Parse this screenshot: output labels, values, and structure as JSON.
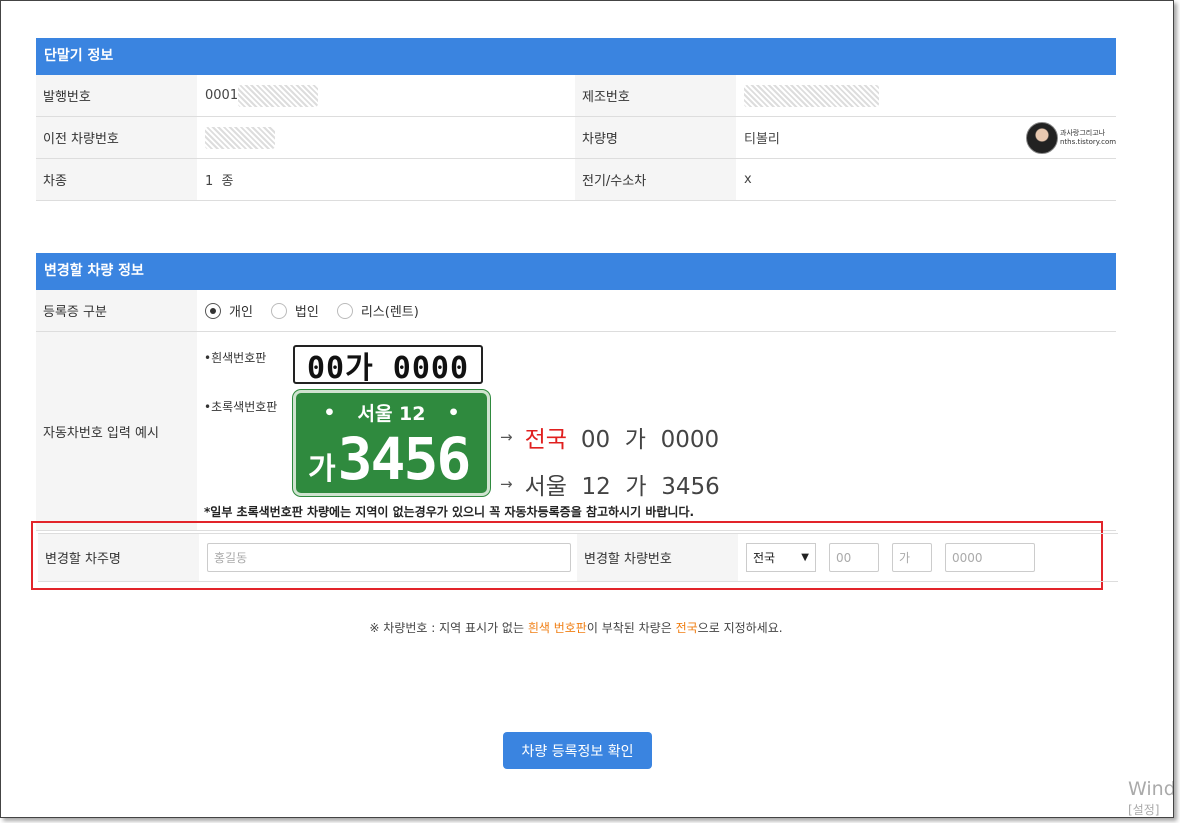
{
  "device_info": {
    "title": "단말기 정보",
    "rows": [
      {
        "l1": "발행번호",
        "v1": "0001",
        "l2": "제조번호",
        "v2": ""
      },
      {
        "l1": "이전 차량번호",
        "v1": "",
        "l2": "차량명",
        "v2": "티볼리"
      },
      {
        "l1": "차종",
        "v1": "1  종",
        "l2": "전기/수소차",
        "v2": "x"
      }
    ]
  },
  "change_info": {
    "title": "변경할 차량 정보",
    "reg_label": "등록증 구분",
    "reg_options": [
      "개인",
      "법인",
      "리스(렌트)"
    ],
    "reg_selected": "개인",
    "example_label": "자동차번호 입력 예시",
    "white_plate_label": "•흰색번호판",
    "white_plate_text": "00가 0000",
    "white_result_region": "전국",
    "white_result_rest": "00  가  0000",
    "green_plate_label": "•초록색번호판",
    "green_plate_top": "서울 12",
    "green_plate_ga": "가",
    "green_plate_num": "3456",
    "green_result": "서울  12  가  3456",
    "note": "*일부 초록색번호판 차량에는 지역이 없는경우가 있으니 꼭 자동차등록증을 참고하시기 바랍니다."
  },
  "form": {
    "owner_label": "변경할 차주명",
    "owner_placeholder": "홍길동",
    "plate_label": "변경할 차량번호",
    "region_selected": "전국",
    "num1_placeholder": "00",
    "hangul_placeholder": "가",
    "num2_placeholder": "0000"
  },
  "notice": {
    "part1": "※ 차량번호 : 지역 표시가 없는 ",
    "highlight1": "흰색 번호판",
    "part2": "이 부착된 차량은 ",
    "highlight2": "전국",
    "part3": "으로 지정하세요."
  },
  "confirm_button": "차량 등록정보 확인",
  "watermark": {
    "line1": "과사랑그리고나",
    "line2": "nths.tistory.com"
  },
  "windows": {
    "line1": "Wind",
    "line2": "[설정]"
  },
  "colors": {
    "accent": "#3a84e0",
    "red": "#e0201f",
    "orange": "#f07f14",
    "plate_green": "#2f8a3e"
  }
}
